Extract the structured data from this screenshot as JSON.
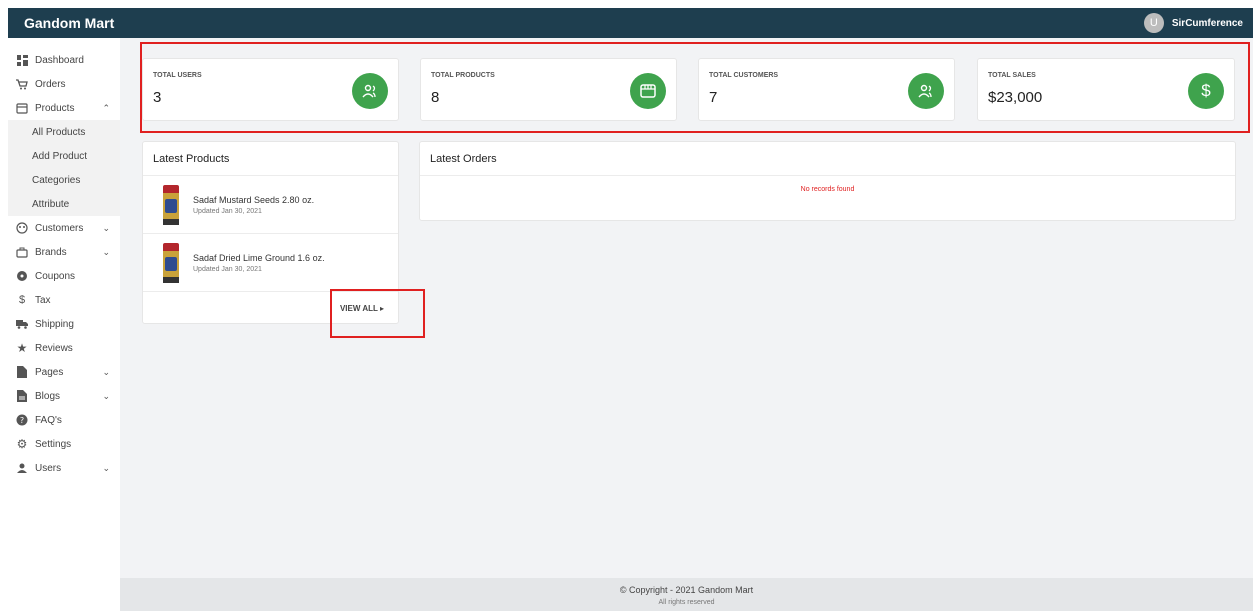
{
  "app": {
    "brand": "Gandom Mart"
  },
  "user": {
    "initial": "U",
    "name": "SirCumference"
  },
  "sidebar": {
    "items": [
      {
        "label": "Dashboard",
        "icon": "dashboard-icon"
      },
      {
        "label": "Orders",
        "icon": "cart-icon"
      },
      {
        "label": "Products",
        "icon": "store-icon",
        "expanded": true
      },
      {
        "label": "Customers",
        "icon": "customers-icon",
        "collapsible": true
      },
      {
        "label": "Brands",
        "icon": "brands-icon",
        "collapsible": true
      },
      {
        "label": "Coupons",
        "icon": "coupon-icon"
      },
      {
        "label": "Tax",
        "icon": "dollar-icon"
      },
      {
        "label": "Shipping",
        "icon": "truck-icon"
      },
      {
        "label": "Reviews",
        "icon": "star-icon"
      },
      {
        "label": "Pages",
        "icon": "page-icon",
        "collapsible": true
      },
      {
        "label": "Blogs",
        "icon": "blog-icon",
        "collapsible": true
      },
      {
        "label": "FAQ's",
        "icon": "help-icon"
      },
      {
        "label": "Settings",
        "icon": "gear-icon"
      },
      {
        "label": "Users",
        "icon": "user-icon",
        "collapsible": true
      }
    ],
    "products_sub": [
      "All Products",
      "Add Product",
      "Categories",
      "Attribute"
    ]
  },
  "stats": [
    {
      "label": "TOTAL USERS",
      "value": "3",
      "icon": "users-icon"
    },
    {
      "label": "TOTAL PRODUCTS",
      "value": "8",
      "icon": "store-icon"
    },
    {
      "label": "TOTAL CUSTOMERS",
      "value": "7",
      "icon": "users-icon"
    },
    {
      "label": "TOTAL SALES",
      "value": "$23,000",
      "icon": "dollar-icon"
    }
  ],
  "latest_products": {
    "title": "Latest Products",
    "items": [
      {
        "name": "Sadaf Mustard Seeds 2.80 oz.",
        "updated": "Updated Jan 30, 2021"
      },
      {
        "name": "Sadaf Dried Lime Ground 1.6 oz.",
        "updated": "Updated Jan 30, 2021"
      }
    ],
    "view_all": "VIEW ALL"
  },
  "latest_orders": {
    "title": "Latest Orders",
    "empty": "No records found"
  },
  "footer": {
    "copyright": "© Copyright - 2021 Gandom Mart",
    "rights": "All rights reserved"
  },
  "colors": {
    "topbar": "#1e3e4f",
    "accent": "#3fa34d",
    "highlight": "#e02020"
  }
}
